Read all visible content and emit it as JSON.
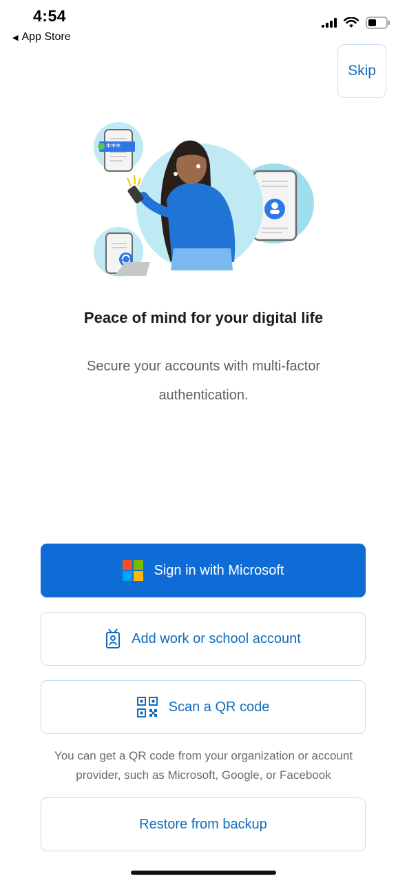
{
  "status_bar": {
    "time": "4:54",
    "back_label": "App Store",
    "icons": [
      "signal-icon",
      "wifi-icon",
      "battery-icon"
    ]
  },
  "onboarding": {
    "skip_label": "Skip",
    "title": "Peace of mind for your digital life",
    "subtitle": "Secure your accounts with multi-factor authentication."
  },
  "actions": {
    "sign_in_label": "Sign in with Microsoft",
    "add_account_label": "Add work or school account",
    "scan_qr_label": "Scan a QR code",
    "qr_helper_text": "You can get a QR code from your organization or account provider, such as Microsoft, Google, or Facebook",
    "restore_label": "Restore from backup"
  },
  "colors": {
    "primary": "#0f6cd6",
    "link": "#0f6cbd",
    "outline": "#c9dcef"
  }
}
